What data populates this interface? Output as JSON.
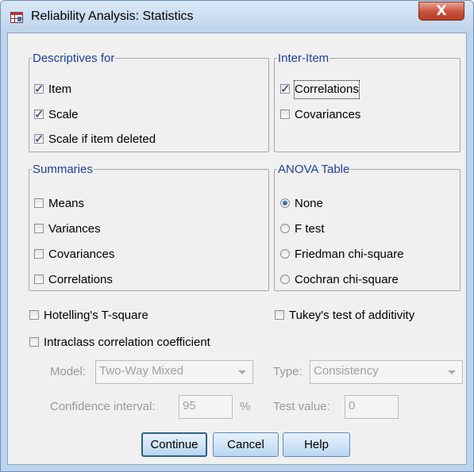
{
  "window": {
    "title": "Reliability Analysis: Statistics",
    "close_glyph": "X"
  },
  "descriptives": {
    "legend": "Descriptives for",
    "items": [
      {
        "label": "Item",
        "checked": true
      },
      {
        "label": "Scale",
        "checked": true
      },
      {
        "label": "Scale if item deleted",
        "checked": true
      }
    ]
  },
  "inter_item": {
    "legend": "Inter-Item",
    "items": [
      {
        "label": "Correlations",
        "checked": true
      },
      {
        "label": "Covariances",
        "checked": false
      }
    ]
  },
  "summaries": {
    "legend": "Summaries",
    "items": [
      {
        "label": "Means",
        "checked": false
      },
      {
        "label": "Variances",
        "checked": false
      },
      {
        "label": "Covariances",
        "checked": false
      },
      {
        "label": "Correlations",
        "checked": false
      }
    ]
  },
  "anova": {
    "legend": "ANOVA Table",
    "items": [
      {
        "label": "None",
        "selected": true
      },
      {
        "label": "F test",
        "selected": false
      },
      {
        "label": "Friedman chi-square",
        "selected": false
      },
      {
        "label": "Cochran chi-square",
        "selected": false
      }
    ]
  },
  "hotelling": {
    "label": "Hotelling's T-square",
    "checked": false
  },
  "tukey": {
    "label": "Tukey's test of additivity",
    "checked": false
  },
  "intraclass": {
    "label": "Intraclass correlation coefficient",
    "checked": false
  },
  "icc": {
    "model_label": "Model:",
    "model_value": "Two-Way Mixed",
    "type_label": "Type:",
    "type_value": "Consistency",
    "ci_label": "Confidence interval:",
    "ci_value": "95",
    "ci_unit": "%",
    "test_label": "Test value:",
    "test_value": "0"
  },
  "buttons": {
    "continue": "Continue",
    "cancel": "Cancel",
    "help": "Help"
  },
  "colors": {
    "legend": "#1e3e97",
    "titlebar": "#bcd3ec",
    "dialog": "#f0f0f0",
    "close": "#c9513a"
  },
  "icons": {
    "app": "spss-table-icon",
    "check": "checkmark-icon"
  }
}
